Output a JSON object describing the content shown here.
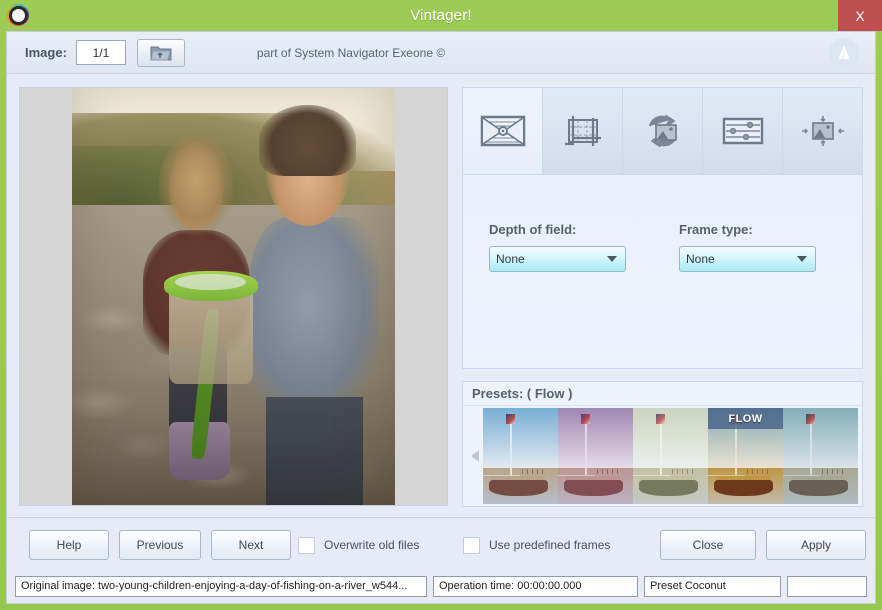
{
  "window": {
    "title": "Vintager!",
    "app_icon": "camera-lens-icon",
    "close_label": "X"
  },
  "toolbar": {
    "image_label": "Image:",
    "image_value": "1/1",
    "image_placeholder": "1/1",
    "open_icon": "folder-open-icon",
    "credit": "part of System Navigator Exeone ©",
    "brand_icon": "sailboat-brand-icon"
  },
  "preview": {
    "alt": "two young children on a rocky riverbed holding a green bug catcher"
  },
  "tabs": [
    {
      "name": "tab-vignette",
      "icon": "vignette-frame-icon",
      "active": true
    },
    {
      "name": "tab-crop",
      "icon": "crop-grid-icon",
      "active": false
    },
    {
      "name": "tab-rotate",
      "icon": "rotate-image-icon",
      "active": false
    },
    {
      "name": "tab-adjust",
      "icon": "sliders-icon",
      "active": false
    },
    {
      "name": "tab-resize",
      "icon": "resize-image-icon",
      "active": false
    }
  ],
  "panel": {
    "depth_of_field": {
      "label": "Depth of field:",
      "value": "None",
      "options": [
        "None"
      ]
    },
    "frame_type": {
      "label": "Frame type:",
      "value": "None",
      "options": [
        "None"
      ]
    }
  },
  "presets": {
    "header": "Presets: ( Flow )",
    "prev_icon": "chevron-left-icon",
    "next_icon": "chevron-right-icon",
    "items": [
      {
        "name": "preset-1",
        "label": "",
        "sky": "#7fb6d9",
        "sand": "#c8ad86",
        "hull": "#7a4a3a",
        "tint": "rgba(60,110,160,0.10)"
      },
      {
        "name": "preset-2",
        "label": "",
        "sky": "#a192b8",
        "sand": "#c7a491",
        "hull": "#7e4a46",
        "tint": "rgba(150,90,150,0.18)"
      },
      {
        "name": "preset-3",
        "label": "",
        "sky": "#ccd6c2",
        "sand": "#c3bd9e",
        "hull": "#5e6246",
        "tint": "rgba(200,210,180,0.22)"
      },
      {
        "name": "preset-4",
        "label": "FLOW",
        "sky": "#74b0d6",
        "sand": "#c09a4c",
        "hull": "#5a2318",
        "tint": "rgba(190,140,40,0.20)"
      },
      {
        "name": "preset-5",
        "label": "",
        "sky": "#8fb9c4",
        "sand": "#b9b295",
        "hull": "#6c5a4a",
        "tint": "rgba(90,130,140,0.18)"
      }
    ]
  },
  "footer": {
    "buttons": {
      "help": "Help",
      "previous": "Previous",
      "next": "Next",
      "close": "Close",
      "apply": "Apply"
    },
    "checkboxes": [
      {
        "name": "overwrite-old-files",
        "label": "Overwrite old files",
        "checked": false
      },
      {
        "name": "use-predefined-frames",
        "label": "Use predefined frames",
        "checked": false
      }
    ]
  },
  "statusbar": {
    "original_image": "Original image: two-young-children-enjoying-a-day-of-fishing-on-a-river_w544...",
    "operation_time": "Operation time: 00:00:00.000",
    "preset": "Preset Coconut",
    "extra": ""
  }
}
